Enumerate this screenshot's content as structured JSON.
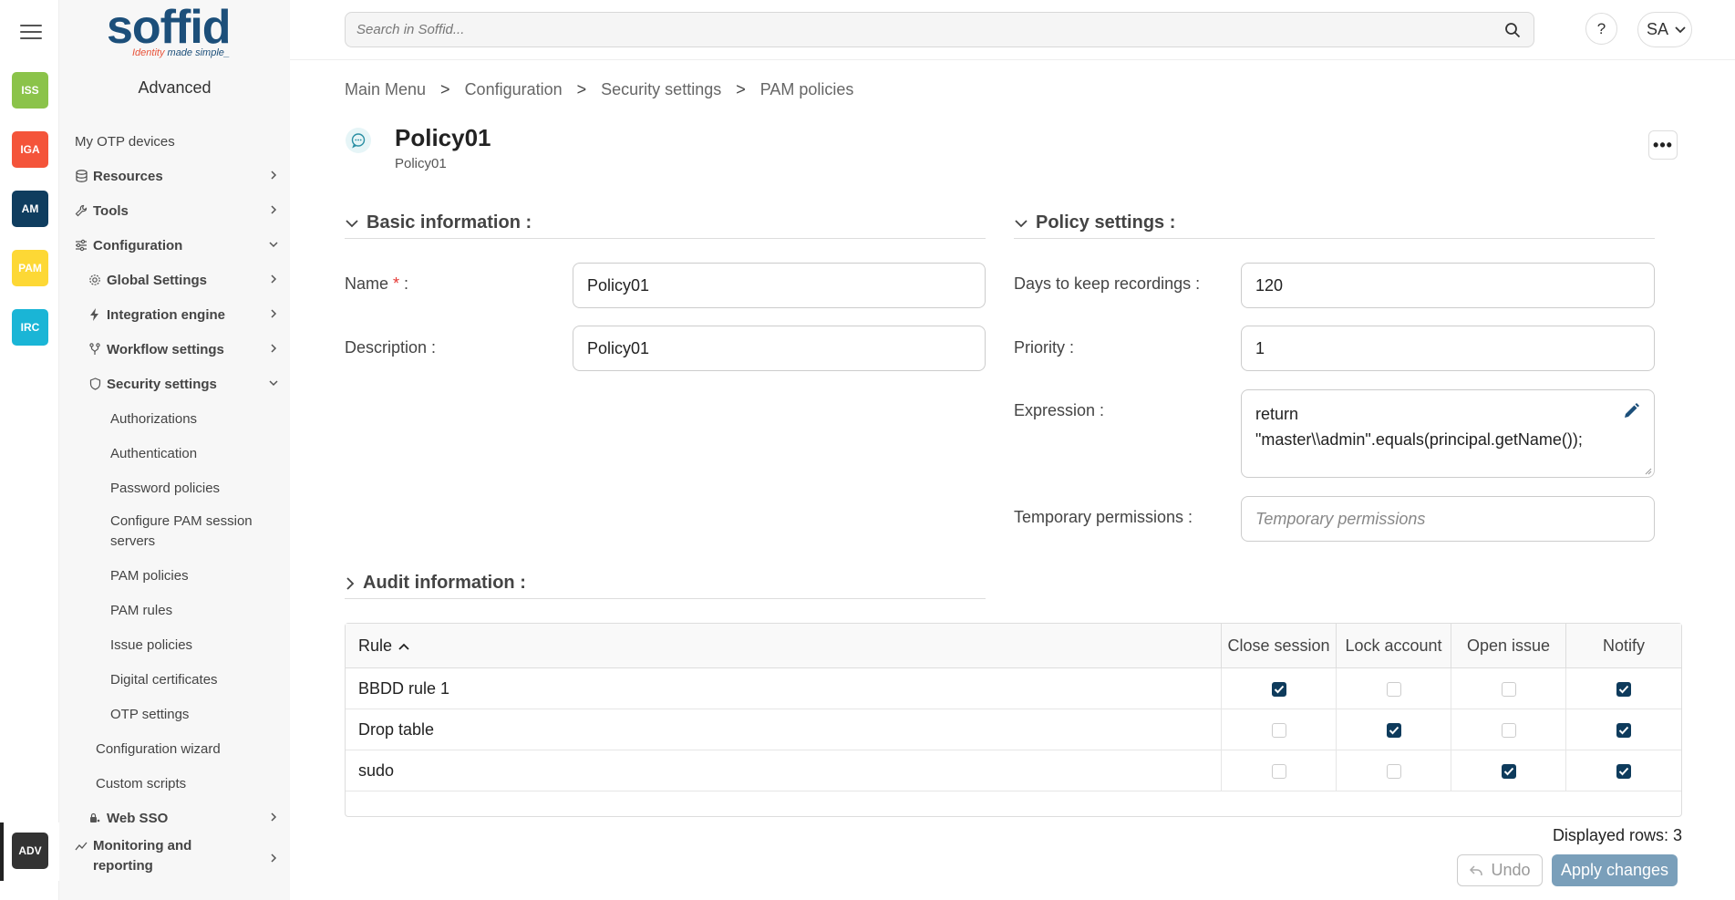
{
  "rail": {
    "modules": [
      {
        "code": "ISS",
        "color": "#8bc34a"
      },
      {
        "code": "IGA",
        "color": "#f4543a"
      },
      {
        "code": "AM",
        "color": "#0f3d5f"
      },
      {
        "code": "PAM",
        "color": "#fdd835"
      },
      {
        "code": "IRC",
        "color": "#1ab5d6"
      },
      {
        "code": "ADV",
        "color": "#333333"
      }
    ]
  },
  "logo": {
    "main": "soffid",
    "sub_a": "Identity",
    "sub_b": " made simple_"
  },
  "sidebar": {
    "title": "Advanced",
    "items": {
      "otp_devices": "My OTP devices",
      "resources": "Resources",
      "tools": "Tools",
      "configuration": "Configuration",
      "global_settings": "Global Settings",
      "integration_engine": "Integration engine",
      "workflow_settings": "Workflow settings",
      "security_settings": "Security settings",
      "authorizations": "Authorizations",
      "authentication": "Authentication",
      "password_policies": "Password policies",
      "pam_session_servers_1": "Configure PAM session",
      "pam_session_servers_2": "servers",
      "pam_policies": "PAM policies",
      "pam_rules": "PAM rules",
      "issue_policies": "Issue policies",
      "digital_certificates": "Digital certificates",
      "otp_settings": "OTP settings",
      "config_wizard": "Configuration wizard",
      "custom_scripts": "Custom scripts",
      "web_sso": "Web SSO",
      "monitoring_1": "Monitoring and",
      "monitoring_2": "reporting"
    }
  },
  "topbar": {
    "search_placeholder": "Search in Soffid...",
    "help": "?",
    "user": "SA"
  },
  "breadcrumb": [
    "Main Menu",
    "Configuration",
    "Security settings",
    "PAM policies"
  ],
  "breadcrumb_sep": ">",
  "object": {
    "title": "Policy01",
    "subtitle": "Policy01",
    "more": "•••"
  },
  "basic": {
    "heading": "Basic information :",
    "name_label": "Name",
    "req": " *",
    "colon": " :",
    "name_value": "Policy01",
    "desc_label": "Description :",
    "desc_value": "Policy01"
  },
  "policy": {
    "heading": "Policy settings :",
    "days_label": "Days to keep recordings :",
    "days_value": "120",
    "priority_label": "Priority :",
    "priority_value": "1",
    "expr_label": "Expression :",
    "expr_line1": "return",
    "expr_line2": "\"master\\\\admin\".equals(principal.getName());",
    "temp_label": "Temporary permissions :",
    "temp_placeholder": "Temporary permissions"
  },
  "audit": {
    "heading": "Audit information :"
  },
  "table": {
    "columns": [
      "Rule",
      "Close session",
      "Lock account",
      "Open issue",
      "Notify"
    ],
    "rows": [
      {
        "rule": "BBDD rule 1",
        "checks": [
          true,
          false,
          false,
          true
        ]
      },
      {
        "rule": "Drop table",
        "checks": [
          false,
          true,
          false,
          true
        ]
      },
      {
        "rule": "sudo",
        "checks": [
          false,
          false,
          true,
          true
        ]
      }
    ]
  },
  "footer": {
    "rowcount": "Displayed rows: 3",
    "undo": "Undo",
    "apply": "Apply changes"
  }
}
